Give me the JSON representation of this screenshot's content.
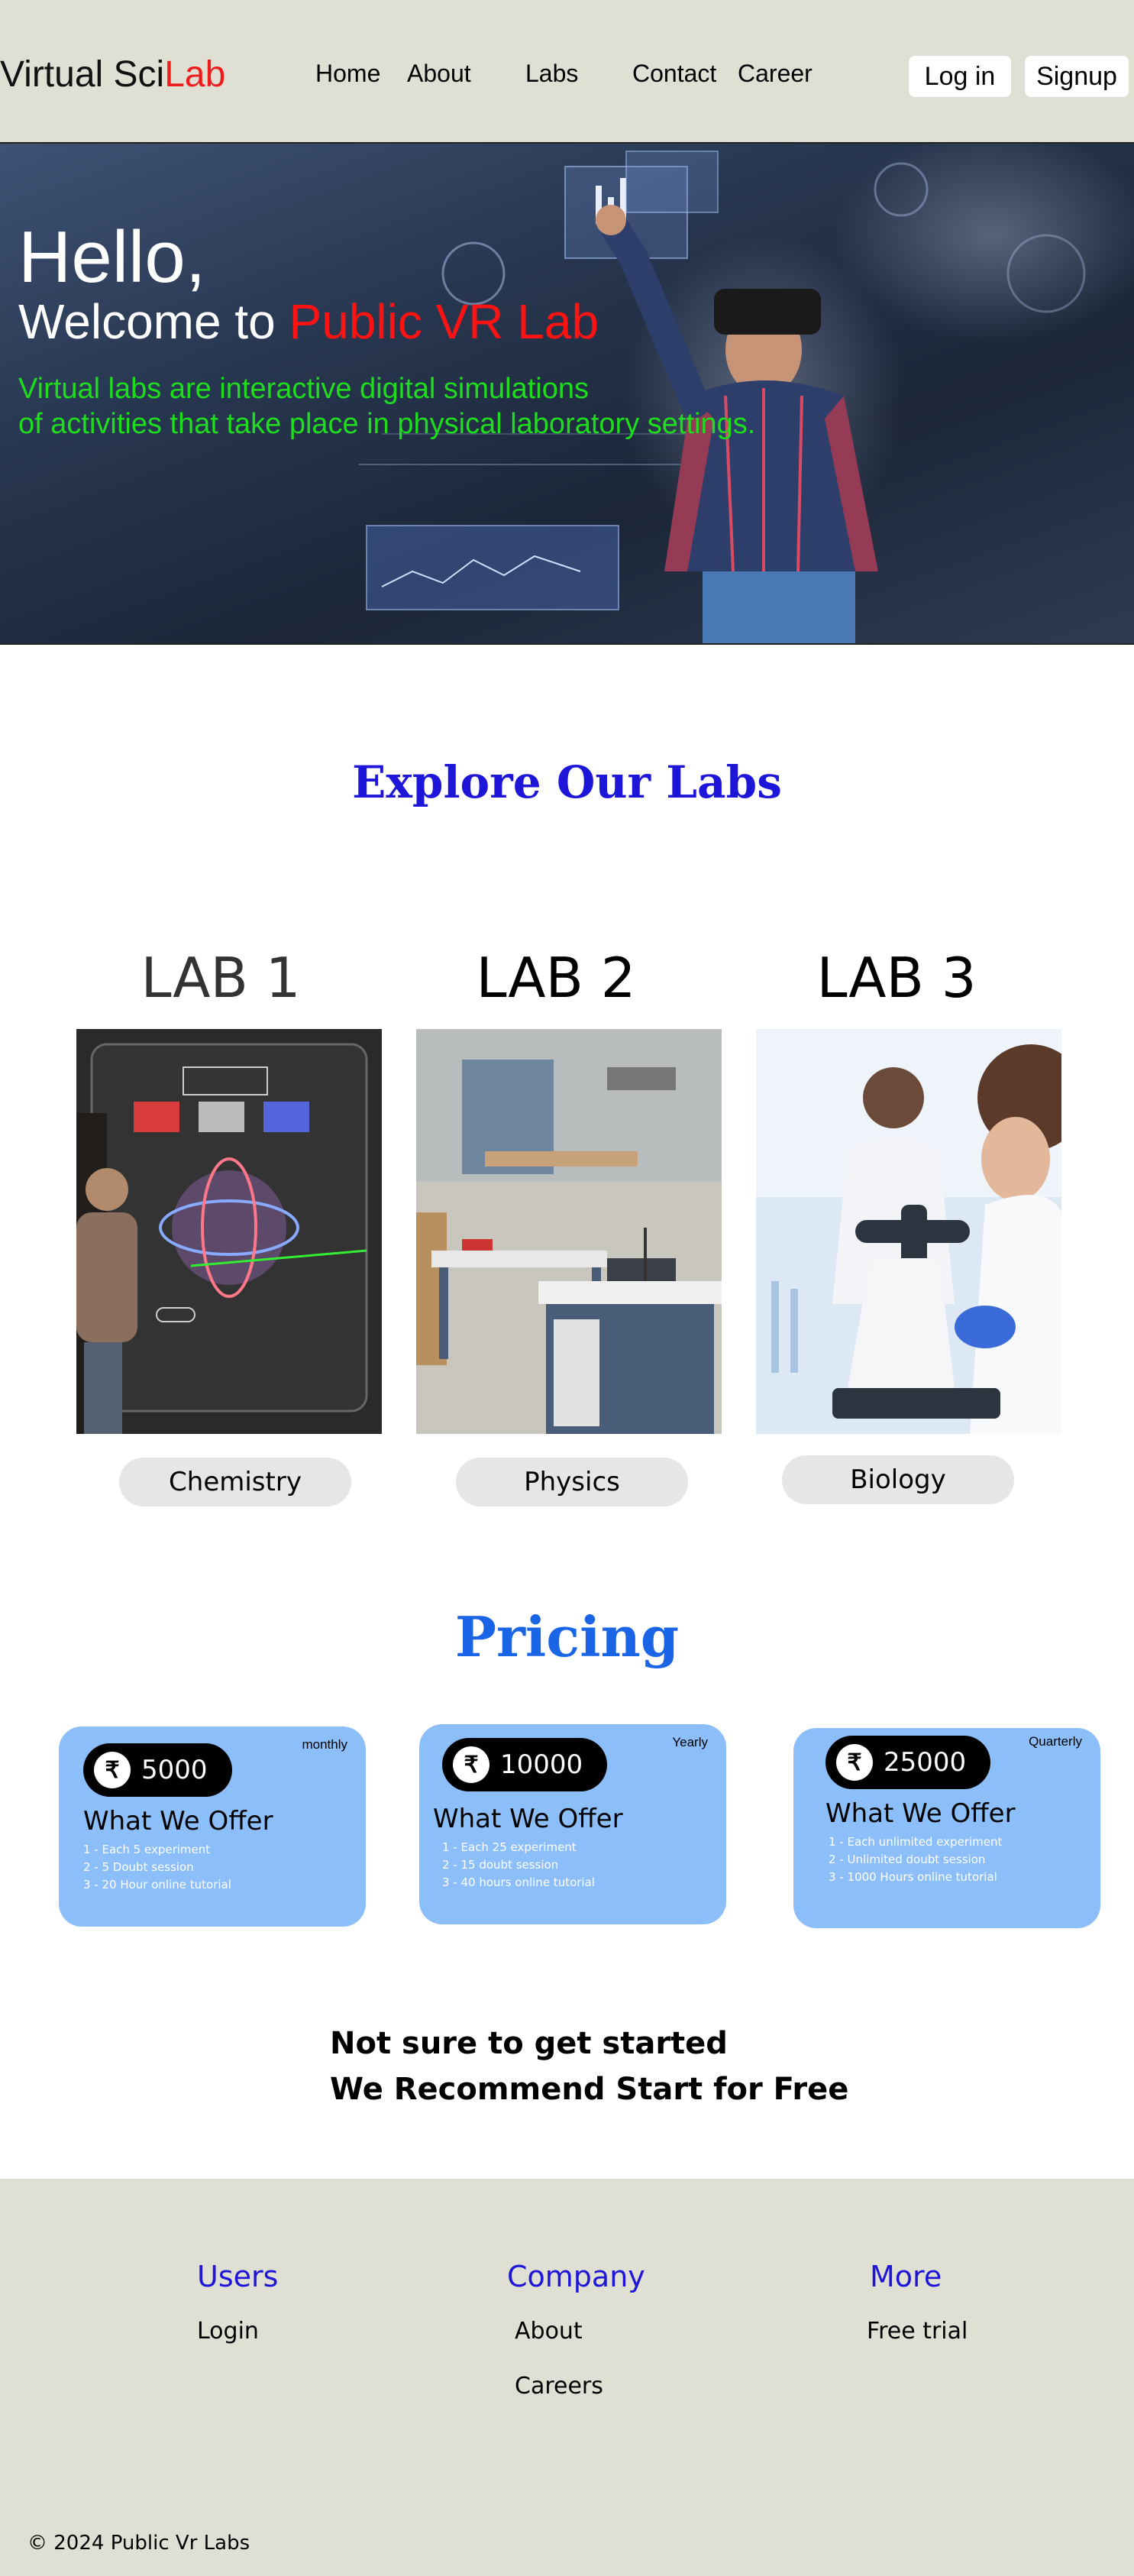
{
  "header": {
    "logo_part1": "Virtual Sci",
    "logo_part2": "Lab",
    "nav": [
      "Home",
      "About",
      "Labs",
      "Contact",
      "Career"
    ],
    "login_label": "Log in",
    "signup_label": "Signup"
  },
  "hero": {
    "greeting": "Hello,",
    "welcome_prefix": "Welcome to ",
    "welcome_highlight": "Public VR Lab",
    "description_line1": "Virtual labs are interactive digital simulations",
    "description_line2": "of activities that take place in physical laboratory settings."
  },
  "labs_section": {
    "title": "Explore Our Labs",
    "labs": [
      {
        "heading": "LAB 1",
        "subject": "Chemistry"
      },
      {
        "heading": "LAB 2",
        "subject": "Physics"
      },
      {
        "heading": "LAB 3",
        "subject": "Biology"
      }
    ]
  },
  "pricing": {
    "title": "Pricing",
    "currency_symbol": "₹",
    "plans": [
      {
        "period": "monthly",
        "price": "5000",
        "heading": "What We Offer",
        "features": [
          "1 - Each 5 experiment",
          "2 - 5 Doubt session",
          "3 - 20 Hour online tutorial"
        ]
      },
      {
        "period": "Yearly",
        "price": "10000",
        "heading": "What We Offer",
        "features": [
          "1 - Each 25 experiment",
          "2 - 15 doubt session",
          "3 - 40 hours online tutorial"
        ]
      },
      {
        "period": "Quarterly",
        "price": "25000",
        "heading": "What We Offer",
        "features": [
          "1 - Each unlimited experiment",
          "2 - Unlimited doubt session",
          "3 - 1000 Hours online tutorial"
        ]
      }
    ]
  },
  "cta": {
    "line1": "Not sure to get started",
    "line2": "We Recommend Start for Free"
  },
  "footer": {
    "columns": [
      {
        "heading": "Users",
        "links": [
          "Login"
        ]
      },
      {
        "heading": "Company",
        "links": [
          "About",
          "Careers"
        ]
      },
      {
        "heading": "More",
        "links": [
          "Free trial"
        ]
      }
    ],
    "copyright": "© 2024 Public Vr Labs"
  },
  "colors": {
    "header_bg": "#dfdfd4",
    "accent_red": "#ee1c1c",
    "hero_text_green": "#1fdc1f",
    "section_blue": "#1d15d8",
    "pricing_blue": "#1a64e6",
    "card_bg": "#8cbffa"
  }
}
